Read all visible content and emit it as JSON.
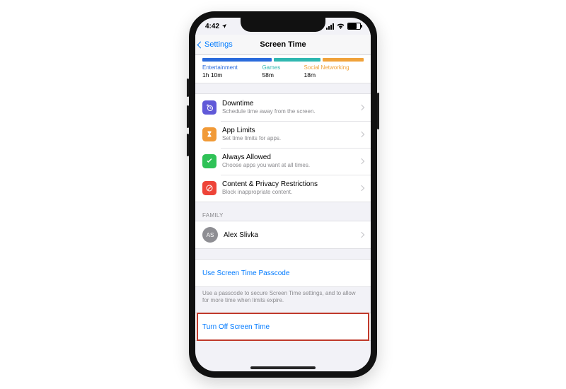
{
  "statusbar": {
    "time": "4:42"
  },
  "nav": {
    "back": "Settings",
    "title": "Screen Time"
  },
  "activity": {
    "entertainment": {
      "label": "Entertainment",
      "time": "1h 10m"
    },
    "games": {
      "label": "Games",
      "time": "58m"
    },
    "social": {
      "label": "Social Networking",
      "time": "18m"
    }
  },
  "menu": [
    {
      "title": "Downtime",
      "sub": "Schedule time away from the screen."
    },
    {
      "title": "App Limits",
      "sub": "Set time limits for apps."
    },
    {
      "title": "Always Allowed",
      "sub": "Choose apps you want at all times."
    },
    {
      "title": "Content & Privacy Restrictions",
      "sub": "Block inappropriate content."
    }
  ],
  "family": {
    "header": "FAMILY",
    "initials": "AS",
    "name": "Alex Slivka"
  },
  "passcode": {
    "link": "Use Screen Time Passcode",
    "note": "Use a passcode to secure Screen Time settings, and to allow for more time when limits expire."
  },
  "turn_off": "Turn Off Screen Time"
}
